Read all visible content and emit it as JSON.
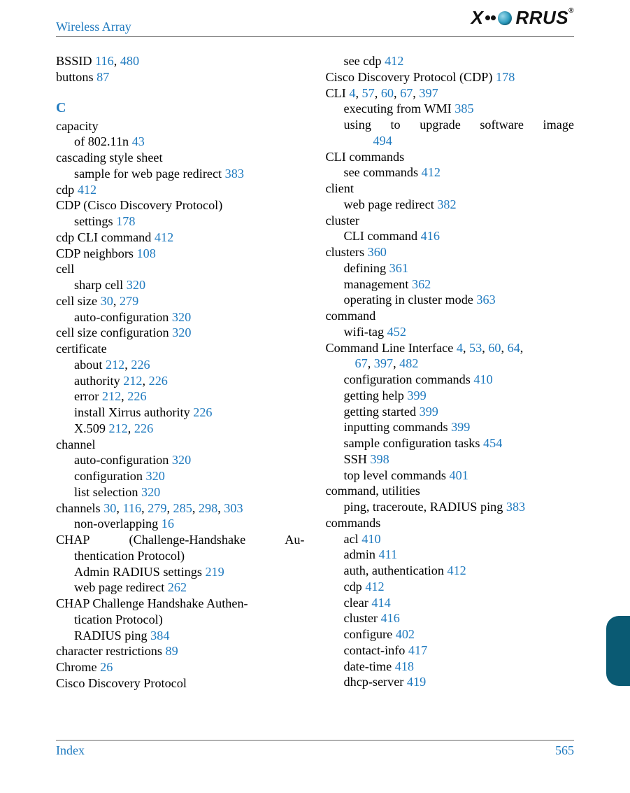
{
  "header": {
    "title": "Wireless Array",
    "logo_text": "RRUS",
    "logo_reg": "®"
  },
  "footer": {
    "left": "Index",
    "right": "565"
  },
  "left": {
    "bssid": {
      "t": "BSSID ",
      "r1": "116",
      "c": ", ",
      "r2": "480"
    },
    "buttons": {
      "t": "buttons ",
      "r": "87"
    },
    "section": "C",
    "capacity": {
      "t": "capacity",
      "sub_t": "of 802.11n ",
      "sub_r": "43"
    },
    "css": {
      "t": "cascading style sheet",
      "sub_t": "sample for web page redirect ",
      "sub_r": "383"
    },
    "cdp": {
      "t": "cdp ",
      "r": "412"
    },
    "cdp2": {
      "t": "CDP (Cisco Discovery Protocol)",
      "sub_t": "settings ",
      "sub_r": "178"
    },
    "cdpcli": {
      "t": "cdp CLI command ",
      "r": "412"
    },
    "cdpn": {
      "t": "CDP neighbors ",
      "r": "108"
    },
    "cell": {
      "t": "cell",
      "sub_t": "sharp cell ",
      "sub_r": "320"
    },
    "cellsize": {
      "t": "cell size ",
      "r1": "30",
      "c": ", ",
      "r2": "279",
      "sub_t": "auto-configuration ",
      "sub_r": "320"
    },
    "cellsizecfg": {
      "t": "cell size configuration ",
      "r": "320"
    },
    "cert": {
      "t": "certificate",
      "about": {
        "t": "about ",
        "r1": "212",
        "c": ", ",
        "r2": "226"
      },
      "auth": {
        "t": "authority ",
        "r1": "212",
        "c": ", ",
        "r2": "226"
      },
      "err": {
        "t": "error ",
        "r1": "212",
        "c": ", ",
        "r2": "226"
      },
      "inst": {
        "t": "install Xirrus authority ",
        "r": "226"
      },
      "x509": {
        "t": "X.509 ",
        "r1": "212",
        "c": ", ",
        "r2": "226"
      }
    },
    "channel": {
      "t": "channel",
      "auto": {
        "t": "auto-configuration ",
        "r": "320"
      },
      "cfg": {
        "t": "configuration ",
        "r": "320"
      },
      "list": {
        "t": "list selection ",
        "r": "320"
      }
    },
    "channels": {
      "t": "channels ",
      "r": [
        "30",
        "116",
        "279",
        "285",
        "298",
        "303"
      ],
      "sub_t": "non-overlapping ",
      "sub_r": "16"
    },
    "chap1": {
      "line1a": "CHAP",
      "line1b": "(Challenge-Handshake",
      "line1c": "Au-",
      "line2": "thentication Protocol)",
      "admin": {
        "t": "Admin RADIUS settings ",
        "r": "219"
      },
      "wpr": {
        "t": "web page redirect ",
        "r": "262"
      }
    },
    "chap2": {
      "line1": "CHAP Challenge Handshake Authen-",
      "line2": "tication Protocol)",
      "rad": {
        "t": "RADIUS ping ",
        "r": "384"
      }
    },
    "charres": {
      "t": "character restrictions ",
      "r": "89"
    },
    "chrome": {
      "t": "Chrome ",
      "r": "26"
    },
    "cdp3": {
      "t": "Cisco Discovery Protocol"
    }
  },
  "right": {
    "seecdp": {
      "t": "see cdp ",
      "r": "412"
    },
    "cdp": {
      "t": "Cisco Discovery Protocol (CDP) ",
      "r": "178"
    },
    "cli": {
      "t": "CLI ",
      "r": [
        "4",
        "57",
        "60",
        "67",
        "397"
      ],
      "exec": {
        "t": "executing from WMI ",
        "r": "385"
      },
      "upg1": "using  to  upgrade  software  image",
      "upg_r": "494"
    },
    "clicmds": {
      "t": "CLI commands",
      "sub_t": "see commands ",
      "sub_r": "412"
    },
    "client": {
      "t": "client",
      "sub_t": "web page redirect ",
      "sub_r": "382"
    },
    "cluster": {
      "t": "cluster",
      "sub_t": "CLI command ",
      "sub_r": "416"
    },
    "clusters": {
      "t": "clusters ",
      "r": "360",
      "def": {
        "t": "defining ",
        "r": "361"
      },
      "mgmt": {
        "t": "management ",
        "r": "362"
      },
      "op": {
        "t": "operating in cluster mode ",
        "r": "363"
      }
    },
    "command": {
      "t": "command",
      "sub_t": "wifi-tag ",
      "sub_r": "452"
    },
    "cmdlinei": {
      "t": "Command Line Interface ",
      "r1": [
        "4",
        "53",
        "60",
        "64"
      ],
      "r2": [
        "67",
        "397",
        "482"
      ],
      "cfgcmds": {
        "t": "configuration commands ",
        "r": "410"
      },
      "help": {
        "t": "getting help ",
        "r": "399"
      },
      "start": {
        "t": "getting started ",
        "r": "399"
      },
      "input": {
        "t": "inputting commands ",
        "r": "399"
      },
      "sample": {
        "t": "sample configuration tasks ",
        "r": "454"
      },
      "ssh": {
        "t": "SSH ",
        "r": "398"
      },
      "top": {
        "t": "top level commands ",
        "r": "401"
      }
    },
    "cmdutil": {
      "t": "command, utilities",
      "sub_t": "ping, traceroute, RADIUS ping ",
      "sub_r": "383"
    },
    "commands": {
      "t": "commands",
      "items": [
        {
          "t": "acl ",
          "r": "410"
        },
        {
          "t": "admin ",
          "r": "411"
        },
        {
          "t": "auth, authentication ",
          "r": "412"
        },
        {
          "t": "cdp ",
          "r": "412"
        },
        {
          "t": "clear ",
          "r": "414"
        },
        {
          "t": "cluster ",
          "r": "416"
        },
        {
          "t": "configure ",
          "r": "402"
        },
        {
          "t": "contact-info ",
          "r": "417"
        },
        {
          "t": "date-time ",
          "r": "418"
        },
        {
          "t": "dhcp-server ",
          "r": "419"
        }
      ]
    }
  }
}
